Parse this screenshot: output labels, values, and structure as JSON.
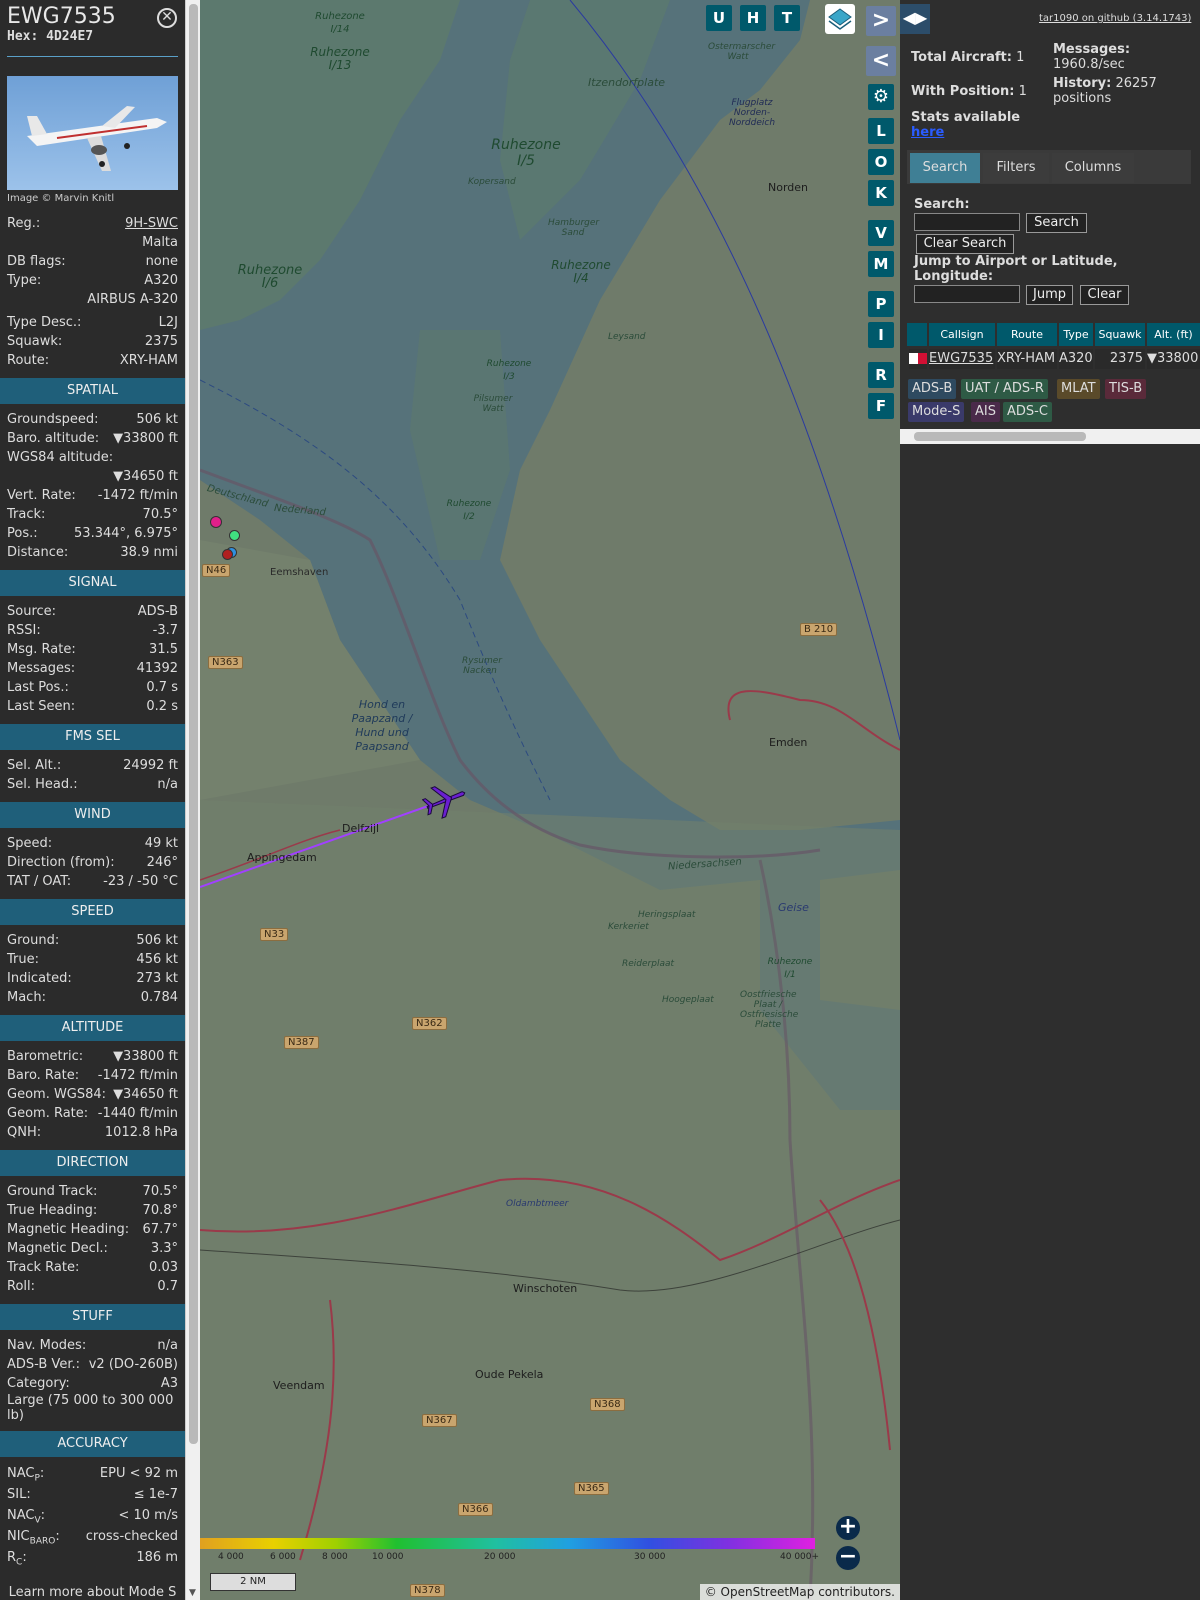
{
  "selected": {
    "callsign": "EWG7535",
    "hex_label": "Hex:",
    "hex": "4D24E7",
    "photo_credit": "Image © Marvin Knitl",
    "reg_label": "Reg.:",
    "reg": "9H-SWC",
    "country": "Malta",
    "dbflags_label": "DB flags:",
    "dbflags": "none",
    "type_label": "Type:",
    "type": "A320",
    "type_name": "AIRBUS A-320",
    "typedesc_label": "Type Desc.:",
    "typedesc": "L2J",
    "squawk_label": "Squawk:",
    "squawk": "2375",
    "route_label": "Route:",
    "route": "XRY-HAM"
  },
  "sections": {
    "spatial": "SPATIAL",
    "signal": "SIGNAL",
    "fms": "FMS SEL",
    "wind": "WIND",
    "speed": "SPEED",
    "altitude": "ALTITUDE",
    "direction": "DIRECTION",
    "stuff": "STUFF",
    "accuracy": "ACCURACY"
  },
  "spatial": [
    {
      "label": "Groundspeed:",
      "value": "506 kt"
    },
    {
      "label": "Baro. altitude:",
      "value": "▼33800 ft"
    },
    {
      "label": "WGS84 altitude:",
      "value": ""
    },
    {
      "label": "",
      "value": "▼34650 ft"
    },
    {
      "label": "Vert. Rate:",
      "value": "-1472 ft/min"
    },
    {
      "label": "Track:",
      "value": "70.5°"
    },
    {
      "label": "Pos.:",
      "value": "53.344°, 6.975°"
    },
    {
      "label": "Distance:",
      "value": "38.9 nmi"
    }
  ],
  "signal": [
    {
      "label": "Source:",
      "value": "ADS-B"
    },
    {
      "label": "RSSI:",
      "value": "-3.7"
    },
    {
      "label": "Msg. Rate:",
      "value": "31.5"
    },
    {
      "label": "Messages:",
      "value": "41392"
    },
    {
      "label": "Last Pos.:",
      "value": "0.7 s"
    },
    {
      "label": "Last Seen:",
      "value": "0.2 s"
    }
  ],
  "fms": [
    {
      "label": "Sel. Alt.:",
      "value": "24992 ft"
    },
    {
      "label": "Sel. Head.:",
      "value": "n/a"
    }
  ],
  "wind": [
    {
      "label": "Speed:",
      "value": "49 kt"
    },
    {
      "label": "Direction (from):",
      "value": "246°"
    },
    {
      "label": "TAT / OAT:",
      "value": "-23 / -50 °C"
    }
  ],
  "speed": [
    {
      "label": "Ground:",
      "value": "506 kt"
    },
    {
      "label": "True:",
      "value": "456 kt"
    },
    {
      "label": "Indicated:",
      "value": "273 kt"
    },
    {
      "label": "Mach:",
      "value": "0.784"
    }
  ],
  "altitude": [
    {
      "label": "Barometric:",
      "value": "▼33800 ft"
    },
    {
      "label": "Baro. Rate:",
      "value": "-1472 ft/min"
    },
    {
      "label": "Geom. WGS84:",
      "value": "▼34650 ft"
    },
    {
      "label": "Geom. Rate:",
      "value": "-1440 ft/min"
    },
    {
      "label": "QNH:",
      "value": "1012.8 hPa"
    }
  ],
  "direction": [
    {
      "label": "Ground Track:",
      "value": "70.5°"
    },
    {
      "label": "True Heading:",
      "value": "70.8°"
    },
    {
      "label": "Magnetic Heading:",
      "value": "67.7°"
    },
    {
      "label": "Magnetic Decl.:",
      "value": "3.3°"
    },
    {
      "label": "Track Rate:",
      "value": "0.03"
    },
    {
      "label": "Roll:",
      "value": "0.7"
    }
  ],
  "stuff": [
    {
      "label": "Nav. Modes:",
      "value": "n/a"
    },
    {
      "label": "ADS-B Ver.:",
      "value": "v2 (DO-260B)"
    },
    {
      "label": "Category:",
      "value": "A3"
    }
  ],
  "stuff_category_desc": "Large (75 000 to 300 000 lb)",
  "accuracy": [
    {
      "label": "NAC",
      "sub": "P",
      "value": "EPU < 92 m"
    },
    {
      "label": "SIL:",
      "sub": "",
      "value": "≤ 1e-7"
    },
    {
      "label": "NAC",
      "sub": "V",
      "value": "< 10 m/s"
    },
    {
      "label": "NIC",
      "sub": "BARO",
      "value": "cross-checked"
    },
    {
      "label": "R",
      "sub": "C",
      "value": "186 m"
    }
  ],
  "footer_note": "Learn more about Mode S data type by hovering over each data label.",
  "map": {
    "buttons_top": [
      "U",
      "H",
      "T"
    ],
    "buttons_side": [
      "L",
      "O",
      "K",
      "V",
      "M",
      "P",
      "I",
      "R",
      "F"
    ],
    "scale": "2 NM",
    "attribution_prefix": "© ",
    "attribution_link": "OpenStreetMap",
    "attribution_suffix": " contributors.",
    "colorbar_labels": [
      "4 000",
      "6 000",
      "8 000",
      "10 000",
      "20 000",
      "30 000",
      "40 000+"
    ],
    "places": [
      {
        "text": "Norden"
      },
      {
        "text": "Emden"
      },
      {
        "text": "Delfzijl"
      },
      {
        "text": "Appingedam"
      },
      {
        "text": "Eemshaven"
      },
      {
        "text": "Winschoten"
      },
      {
        "text": "Veendam"
      },
      {
        "text": "Oude Pekela"
      },
      {
        "text": "Itzendorfplate"
      },
      {
        "text": "Flugplatz Norden-Norddeich"
      },
      {
        "text": "Ostermarscher Watt"
      },
      {
        "text": "Oldambtmeer"
      },
      {
        "text": "Geise"
      },
      {
        "text": "Kopersand"
      },
      {
        "text": "Hamburger Sand"
      },
      {
        "text": "Leysand"
      },
      {
        "text": "Pilsumer Watt"
      },
      {
        "text": "Rysumer Nacken"
      },
      {
        "text": "Heringsplaat"
      },
      {
        "text": "Kerkeriet"
      },
      {
        "text": "Reiderplaat"
      },
      {
        "text": "Hoogeplaat"
      },
      {
        "text": "Oostfriesche Plaat / Ostfriesische Platte"
      },
      {
        "text": "Niedersachsen"
      },
      {
        "text": "Deutschland"
      },
      {
        "text": "Nederland"
      },
      {
        "text": "Hond en Paapzand / Hund und Paapsand"
      }
    ],
    "zones": [
      "Ruhezone I/14",
      "Ruhezone I/13",
      "Ruhezone I/5",
      "Ruhezone I/4",
      "Ruhezone I/6",
      "Ruhezone I/3",
      "Ruhezone I/2",
      "Ruhezone I/1"
    ],
    "roads": [
      "B 210",
      "N46",
      "N363",
      "N33",
      "N362",
      "N387",
      "N367",
      "N368",
      "N366",
      "N365",
      "N378"
    ]
  },
  "right": {
    "version": "tar1090 on github (3.14.1743)",
    "total_label": "Total Aircraft:",
    "total": "1",
    "withpos_label": "With Position:",
    "withpos": "1",
    "stats_label": "Stats available",
    "stats_link": "here",
    "messages_label": "Messages:",
    "messages": "1960.8/sec",
    "history_label": "History:",
    "history": "26257 positions",
    "tabs": [
      "Search",
      "Filters",
      "Columns"
    ],
    "search_label": "Search:",
    "search_btn": "Search",
    "clear_search_btn": "Clear Search",
    "jump_label": "Jump to Airport or Latitude, Longitude:",
    "jump_btn": "Jump",
    "clear_btn": "Clear",
    "table_headers": [
      "Callsign",
      "Route",
      "Type",
      "Squawk",
      "Alt. (ft)"
    ],
    "table_row": {
      "callsign": "EWG7535",
      "route": "XRY-HAM",
      "type": "A320",
      "squawk": "2375",
      "alt": "▼33800"
    },
    "sources": [
      "ADS-B",
      "UAT / ADS-R",
      "MLAT",
      "TIS-B",
      "Mode-S",
      "AIS",
      "ADS-C"
    ]
  },
  "colors": {
    "header_teal": "#00596b",
    "section_blue": "#1f5f7a",
    "track_purple": "#a040ff"
  }
}
